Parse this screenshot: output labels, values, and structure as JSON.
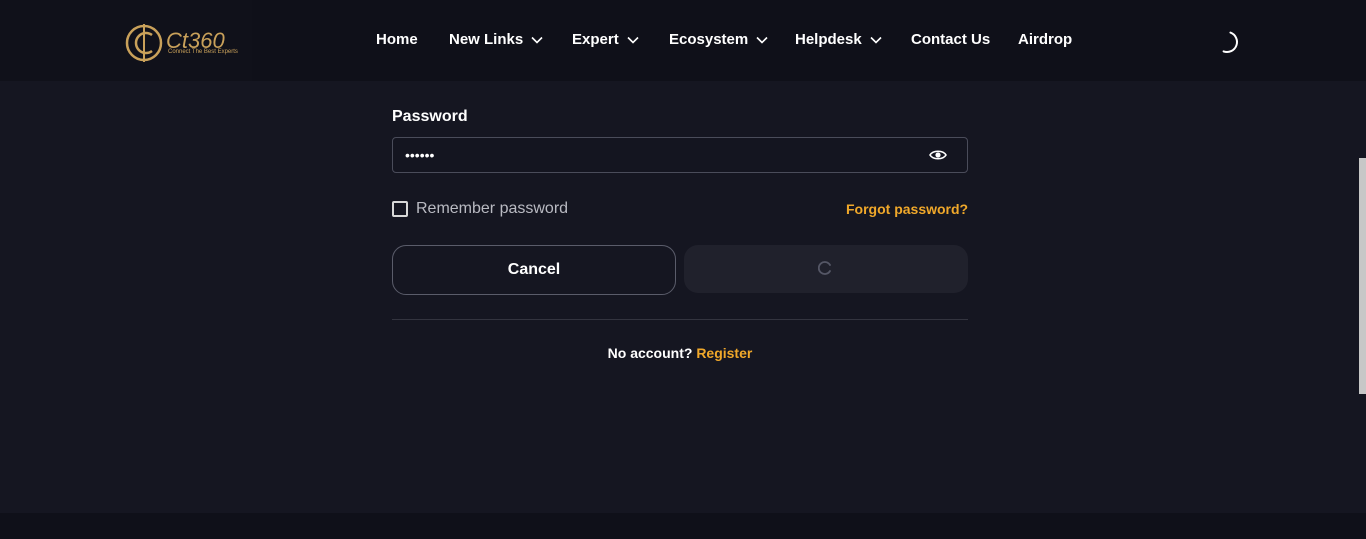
{
  "brand": {
    "logo_text": "Ct360",
    "tagline": "Connect The Best Experts",
    "accent_color": "#c9a15a"
  },
  "nav": {
    "items": [
      {
        "label": "Home",
        "has_dropdown": false
      },
      {
        "label": "New Links",
        "has_dropdown": true
      },
      {
        "label": "Expert",
        "has_dropdown": true
      },
      {
        "label": "Ecosystem",
        "has_dropdown": true
      },
      {
        "label": "Helpdesk",
        "has_dropdown": true
      },
      {
        "label": "Contact Us",
        "has_dropdown": false
      },
      {
        "label": "Airdrop",
        "has_dropdown": false
      }
    ],
    "status_icon": "loading-spinner-icon"
  },
  "login_form": {
    "password_label": "Password",
    "password_value": "••••••",
    "reveal_icon": "eye-icon",
    "remember_label": "Remember password",
    "remember_checked": false,
    "forgot_label": "Forgot password?",
    "cancel_label": "Cancel",
    "submit_state_icon": "loading-spinner-icon",
    "no_account_text": "No account?",
    "register_label": "Register",
    "link_color": "#f0a82a"
  }
}
